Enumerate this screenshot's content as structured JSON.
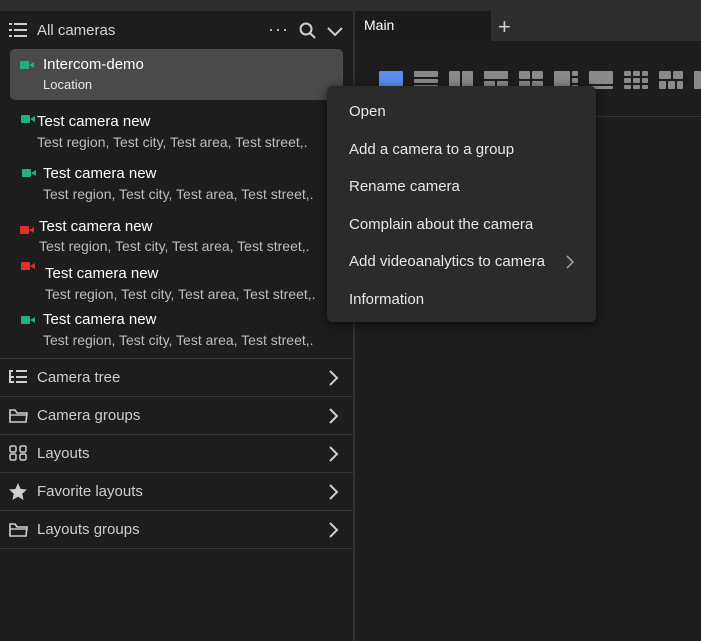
{
  "sidebar": {
    "title": "All cameras",
    "more_label": "···",
    "selected": {
      "name": "Intercom-demo",
      "location": "Location",
      "status": "online"
    },
    "cameras": [
      {
        "name": "Test camera new",
        "location": "Test region, Test city, Test area, Test street,.",
        "status": "online"
      },
      {
        "name": "Test camera new",
        "location": "Test region, Test city, Test area, Test street,.",
        "status": "online"
      },
      {
        "name": "Test camera new",
        "location": "Test region, Test city, Test area, Test street,.",
        "status": "offline"
      },
      {
        "name": "Test camera new",
        "location": "Test region, Test city, Test area, Test street,.",
        "status": "offline"
      },
      {
        "name": "Test camera new",
        "location": "Test region, Test city, Test area, Test street,.",
        "status": "online"
      }
    ],
    "sections": [
      {
        "label": "Camera tree",
        "icon": "tree-icon"
      },
      {
        "label": "Camera groups",
        "icon": "folder-icon"
      },
      {
        "label": "Layouts",
        "icon": "grid-icon"
      },
      {
        "label": "Favorite layouts",
        "icon": "star-icon"
      },
      {
        "label": "Layouts groups",
        "icon": "folder-icon"
      }
    ]
  },
  "tabs": {
    "main_label": "Main",
    "add_label": "+"
  },
  "context_menu": {
    "items": [
      "Open",
      "Add a camera to a group",
      "Rename camera",
      "Complain about the camera",
      "Add videoanalytics to camera",
      "Information"
    ]
  },
  "colors": {
    "online": "#1fb27a",
    "offline": "#e0302a",
    "active_layout": "#5b8def"
  }
}
